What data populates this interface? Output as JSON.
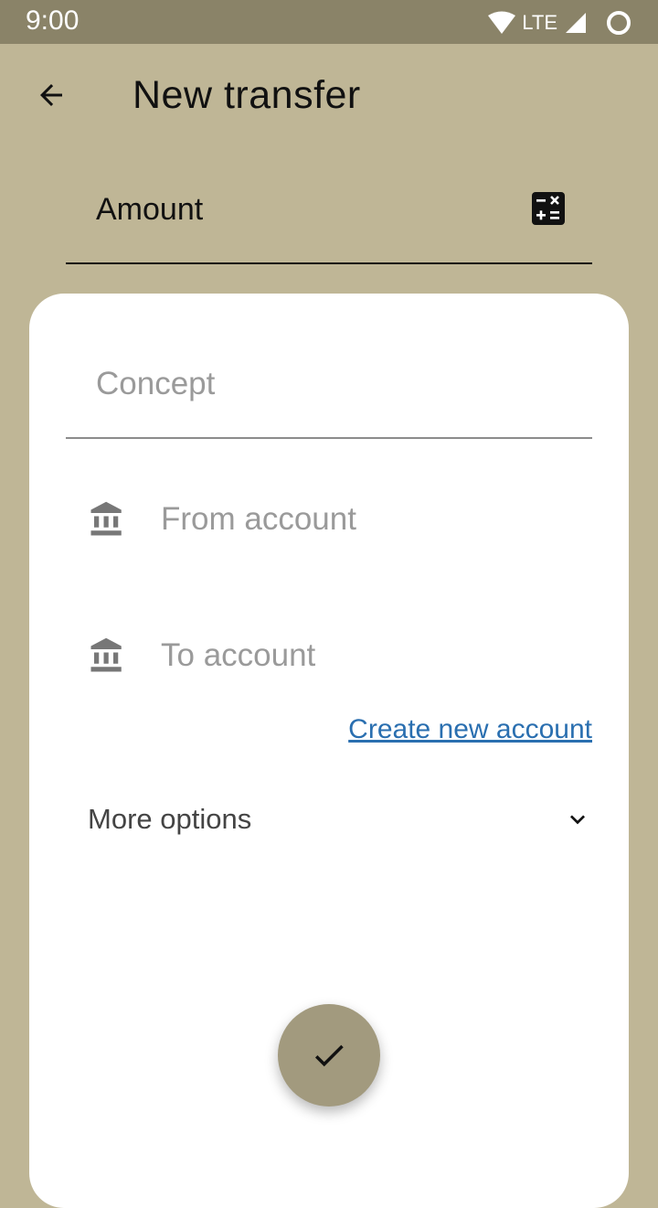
{
  "status_bar": {
    "time": "9:00",
    "network": "LTE",
    "icons": [
      "wifi-icon",
      "signal-icon",
      "circle-icon"
    ]
  },
  "app_bar": {
    "back_icon": "arrow-back-icon",
    "title": "New transfer"
  },
  "amount": {
    "placeholder": "Amount",
    "value": "",
    "calculator_icon": "calculator-icon"
  },
  "form": {
    "concept": {
      "placeholder": "Concept",
      "value": ""
    },
    "from_account": {
      "label": "From account",
      "icon": "bank-icon"
    },
    "to_account": {
      "label": "To account",
      "icon": "bank-icon"
    },
    "create_account_link": "Create new account",
    "more_options": {
      "label": "More options",
      "icon": "chevron-down-icon"
    }
  },
  "fab": {
    "icon": "check-icon"
  },
  "colors": {
    "background": "#bfb696",
    "status_bar": "#8a8368",
    "card": "#ffffff",
    "fab": "#a29a7e",
    "link": "#2a6fb0"
  }
}
